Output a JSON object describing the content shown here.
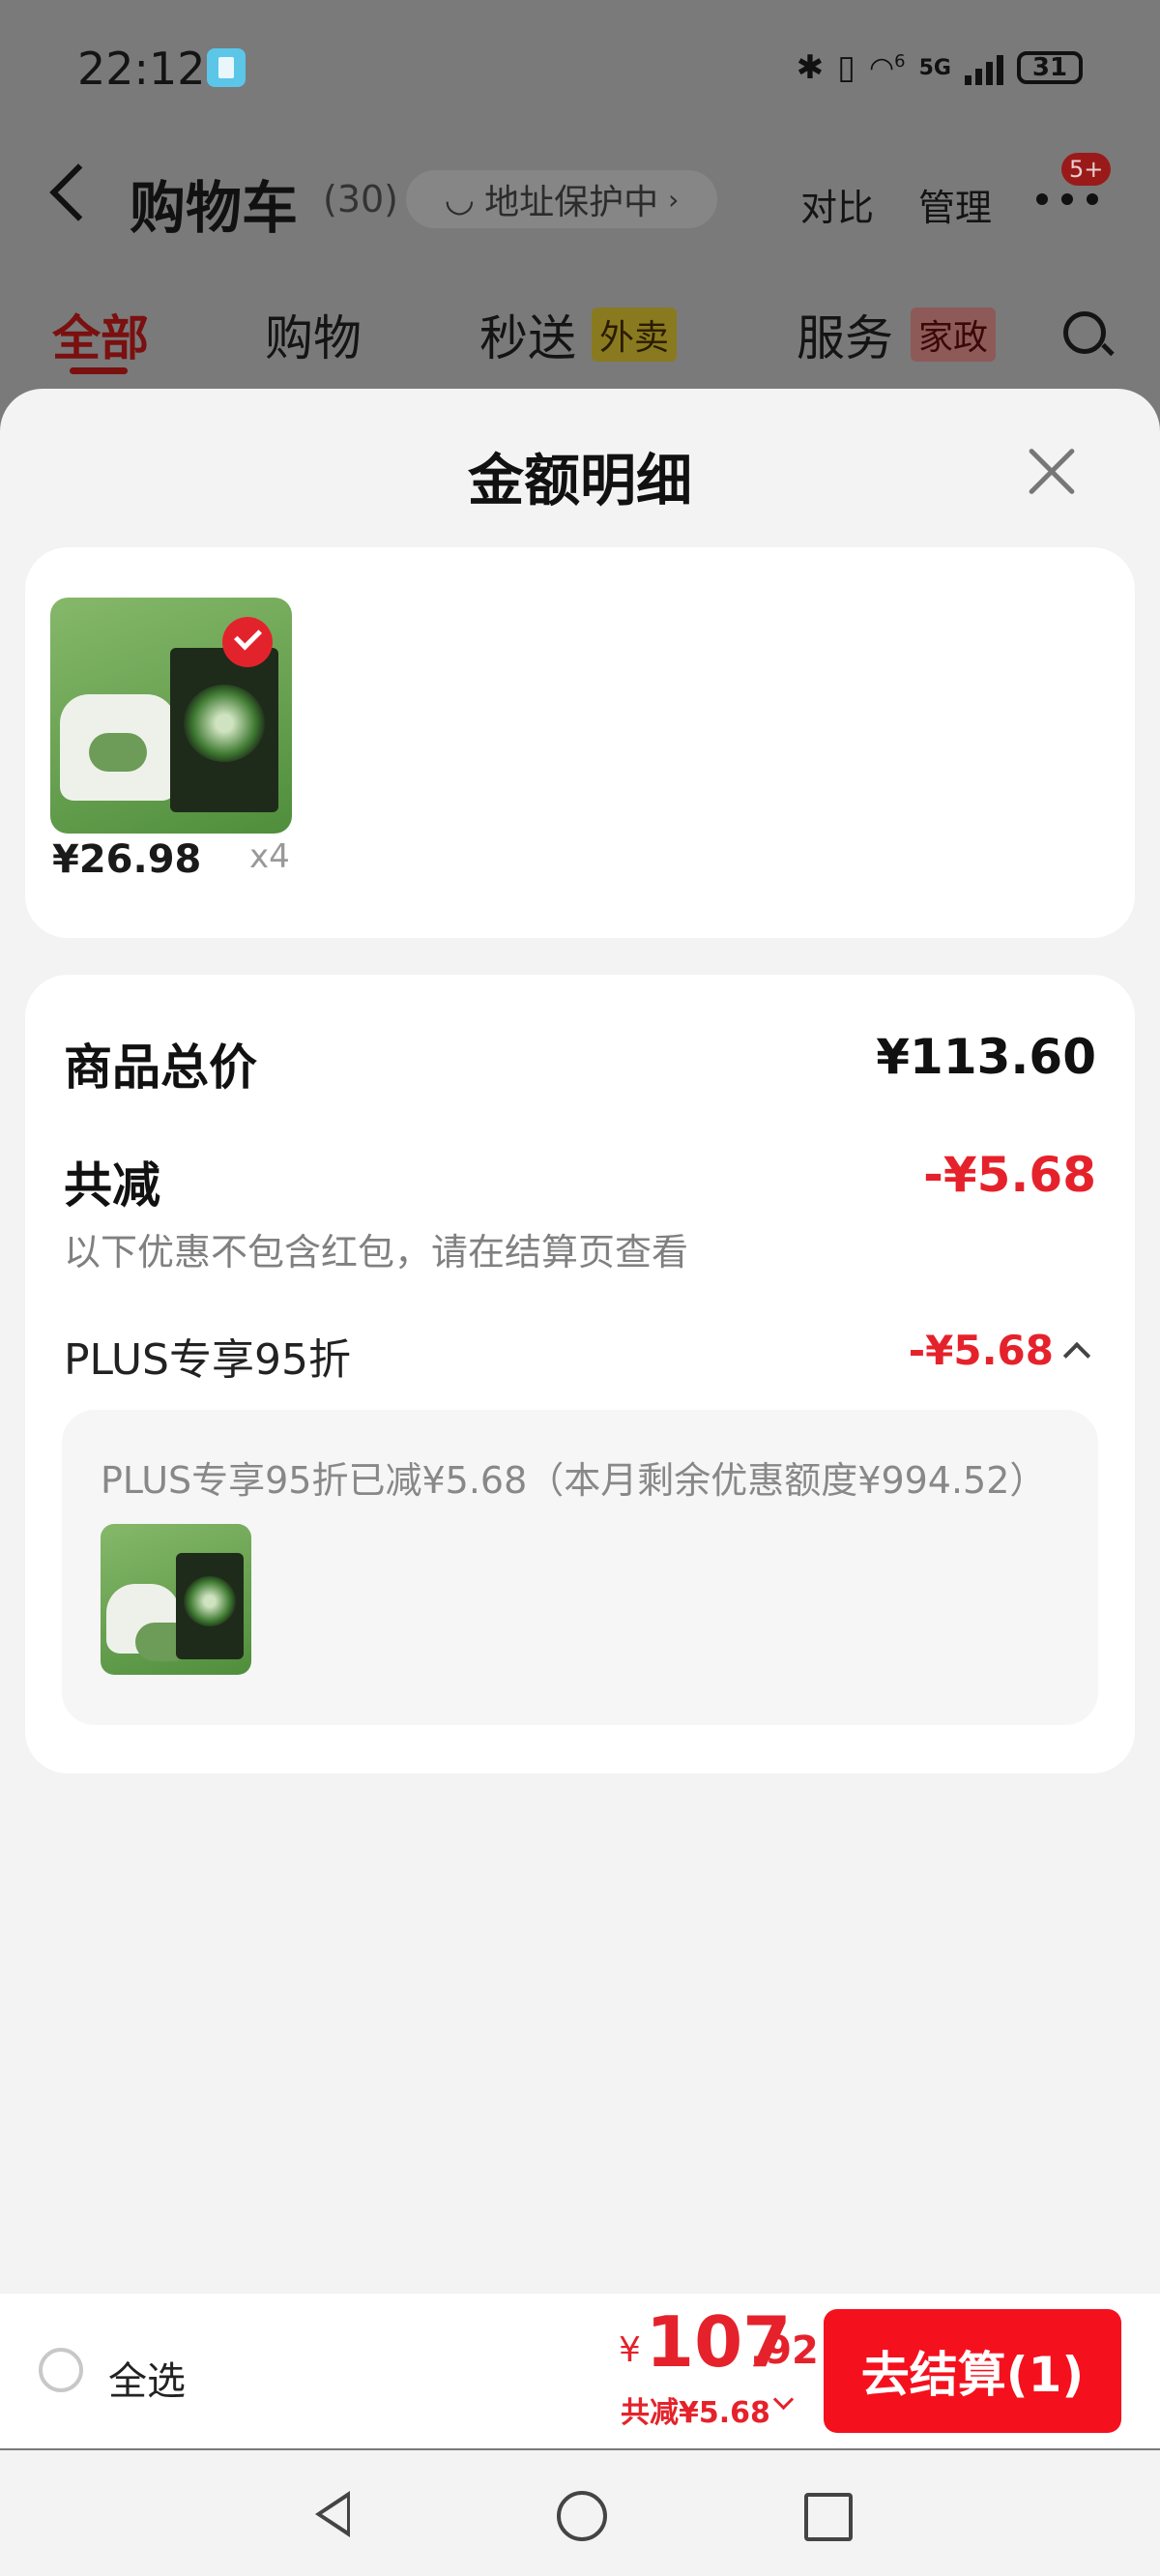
{
  "status_bar": {
    "time": "22:12",
    "network": "5G",
    "wifi_gen": "6",
    "battery": "31"
  },
  "header": {
    "title": "购物车",
    "count": "(30)",
    "address_pill": "地址保护中",
    "compare": "对比",
    "manage": "管理",
    "badge": "5+"
  },
  "tabs": [
    {
      "label": "全部"
    },
    {
      "label": "购物"
    },
    {
      "label": "秒送",
      "tag": "外卖"
    },
    {
      "label": "服务",
      "tag": "家政"
    }
  ],
  "sheet": {
    "title": "金额明细",
    "product": {
      "price": "¥26.98",
      "qty": "x4"
    },
    "total_label": "商品总价",
    "total_value": "¥113.60",
    "reduce_label": "共减",
    "reduce_value": "-¥5.68",
    "note": "以下优惠不包含红包，请在结算页查看",
    "plus_label": "PLUS专享95折",
    "plus_value": "-¥5.68",
    "promo_text": "PLUS专享95折已减¥5.68（本月剩余优惠额度¥994.52）"
  },
  "bottom_bar": {
    "select_all": "全选",
    "currency": "¥",
    "amount_int": "107",
    "amount_dec": ".92",
    "reduce_text": "共减¥5.68",
    "checkout": "去结算(1)"
  },
  "colors": {
    "accent": "#f5101e",
    "price_red": "#e5222b"
  }
}
